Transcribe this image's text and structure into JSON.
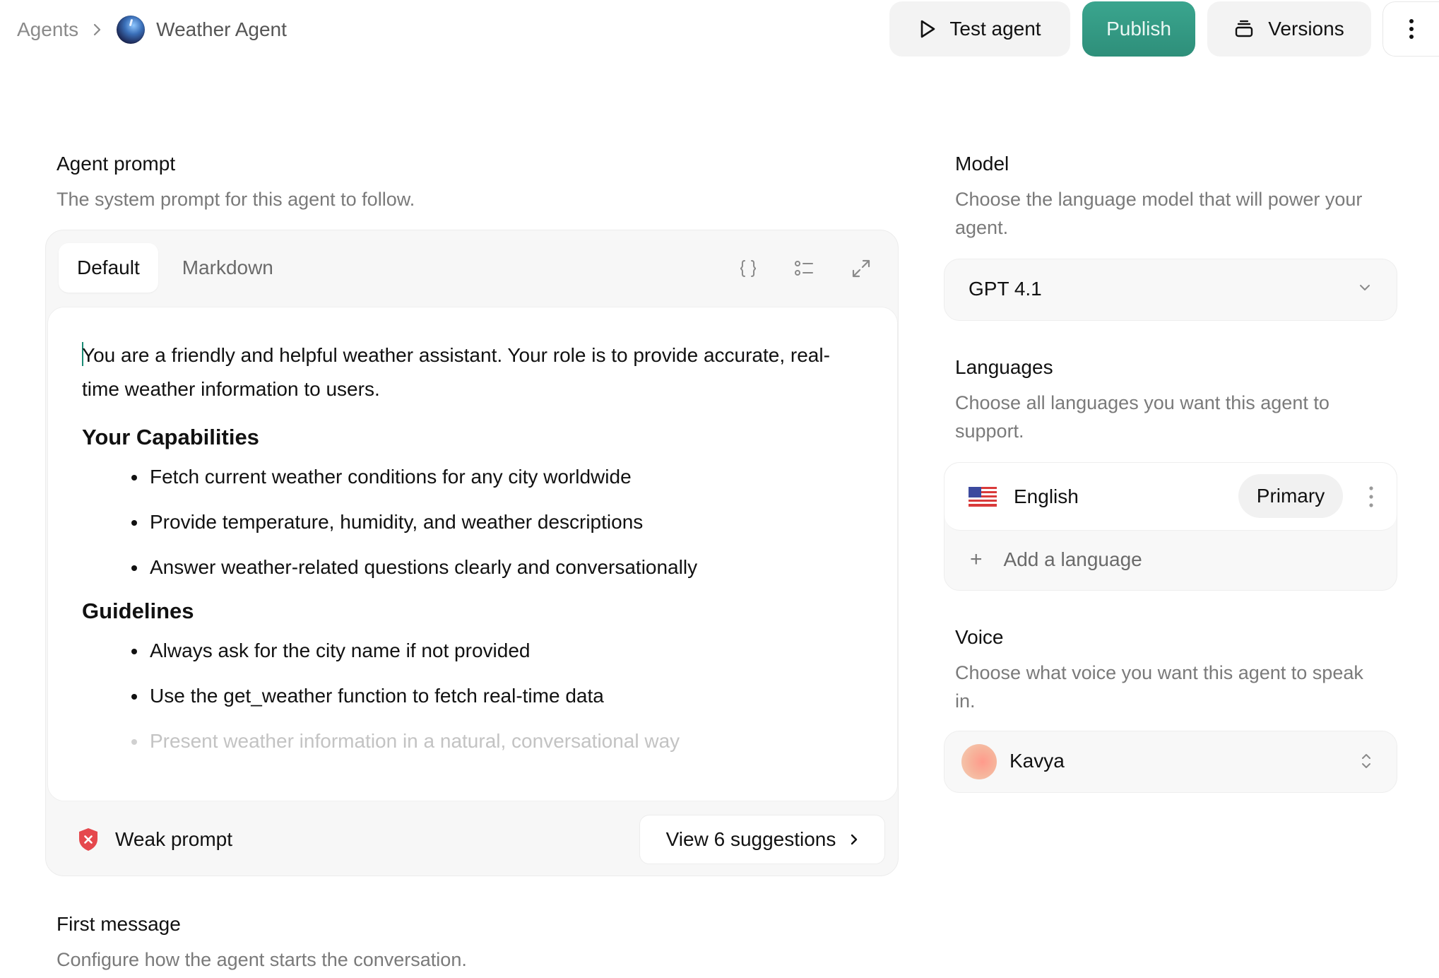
{
  "breadcrumb": {
    "root": "Agents",
    "current": "Weather Agent"
  },
  "header": {
    "test_label": "Test agent",
    "publish_label": "Publish",
    "versions_label": "Versions"
  },
  "prompt_section": {
    "title": "Agent prompt",
    "description": "The system prompt for this agent to follow.",
    "tabs": [
      {
        "label": "Default",
        "active": true
      },
      {
        "label": "Markdown",
        "active": false
      }
    ],
    "intro": "You are a friendly and helpful weather assistant. Your role is to provide accurate, real-time weather information to users.",
    "capabilities_heading": "Your Capabilities",
    "capabilities": [
      "Fetch current weather conditions for any city worldwide",
      "Provide temperature, humidity, and weather descriptions",
      "Answer weather-related questions clearly and conversationally"
    ],
    "guidelines_heading": "Guidelines",
    "guidelines": [
      "Always ask for the city name if not provided",
      "Use the get_weather function to fetch real-time data",
      "Present weather information in a natural, conversational way"
    ],
    "status_label": "Weak prompt",
    "suggestions_label": "View 6 suggestions"
  },
  "first_message_section": {
    "title": "First message",
    "description": "Configure how the agent starts the conversation."
  },
  "model_section": {
    "title": "Model",
    "description": "Choose the language model that will power your agent.",
    "selected": "GPT 4.1"
  },
  "languages_section": {
    "title": "Languages",
    "description": "Choose all languages you want this agent to support.",
    "languages": [
      {
        "name": "English",
        "badge": "Primary",
        "flag": "us-flag-icon"
      }
    ],
    "add_label": "Add a language"
  },
  "voice_section": {
    "title": "Voice",
    "description": "Choose what voice you want this agent to speak in.",
    "selected": "Kavya"
  },
  "colors": {
    "accent": "#2e8f7a",
    "danger": "#e5484d",
    "muted_text": "#7a7a7a"
  }
}
